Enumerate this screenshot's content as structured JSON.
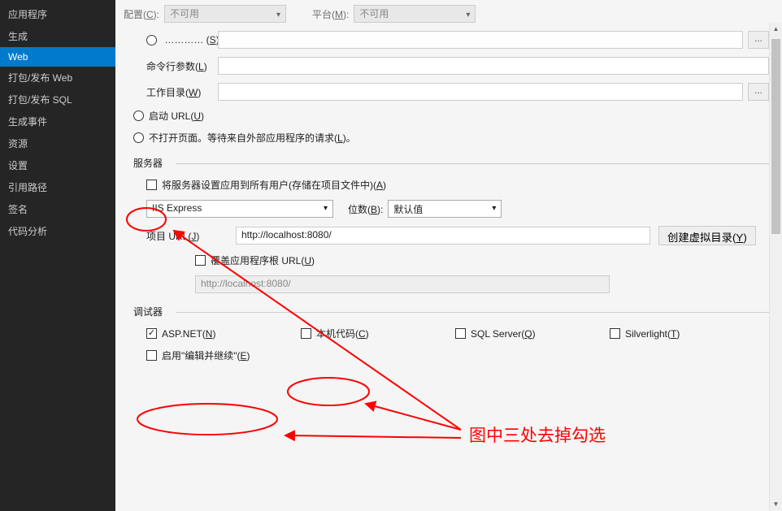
{
  "sidebar": {
    "items": [
      "应用程序",
      "生成",
      "Web",
      "打包/发布 Web",
      "打包/发布 SQL",
      "生成事件",
      "资源",
      "设置",
      "引用路径",
      "签名",
      "代码分析"
    ],
    "activeIndex": 2
  },
  "topbar": {
    "configLabel": "配置(C):",
    "configValue": "不可用",
    "platformLabel": "平台(M):",
    "platformValue": "不可用"
  },
  "start": {
    "cmdArgsLabel": "命令行参数(L)",
    "workDirLabel": "工作目录(W)",
    "startUrlLabel": "启动 URL(U)",
    "noOpenLabel": "不打开页面。等待来自外部应用程序的请求(L)。"
  },
  "server": {
    "legend": "服务器",
    "applyAllLabel": "将服务器设置应用到所有用户(存储在项目文件中)(A)",
    "serverType": "IIS Express",
    "bitnessLabel": "位数(B):",
    "bitnessValue": "默认值",
    "projectUrlLabel": "项目 URL(J)",
    "projectUrlValue": "http://localhost:8080/",
    "createVDirLabel": "创建虚拟目录(Y)",
    "overrideRootLabel": "覆盖应用程序根 URL(U)",
    "overrideRootValue": "http://localhost:8080/"
  },
  "debugger": {
    "legend": "调试器",
    "aspnetLabel": "ASP.NET(N)",
    "nativeLabel": "本机代码(C)",
    "sqlLabel": "SQL Server(Q)",
    "silverlightLabel": "Silverlight(T)",
    "editContinueLabel": "启用\"编辑并继续\"(E)"
  },
  "ellipsis": "...",
  "annotation": "图中三处去掉勾选"
}
